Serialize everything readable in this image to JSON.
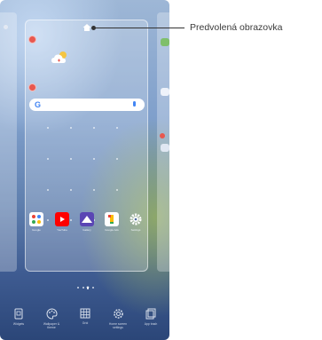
{
  "callout": {
    "label": "Predvolená obrazovka"
  },
  "search": {
    "logo": "G"
  },
  "dock_apps": [
    {
      "label": "Google",
      "icon": "google-folder-icon",
      "color": "#ffffff"
    },
    {
      "label": "YouTube",
      "icon": "youtube-icon",
      "color": "#ff0000"
    },
    {
      "label": "Gallery",
      "icon": "gallery-icon",
      "color": "#5a46b4"
    },
    {
      "label": "Google Ads",
      "icon": "google-one-icon",
      "color": "#ffffff"
    },
    {
      "label": "Settings",
      "icon": "gear-icon",
      "color": "#ffffff"
    }
  ],
  "bottom_menu": [
    {
      "label": "Widgets",
      "icon": "widgets-icon"
    },
    {
      "label": "Wallpaper &\ntheme",
      "icon": "palette-icon"
    },
    {
      "label": "Grid",
      "icon": "grid-icon"
    },
    {
      "label": "Home screen\nsettings",
      "icon": "gear-icon"
    },
    {
      "label": "App trash",
      "icon": "trash-icon"
    }
  ],
  "colors": {
    "accent_red": "#e8584f",
    "callout_text": "#3a3a3a"
  }
}
